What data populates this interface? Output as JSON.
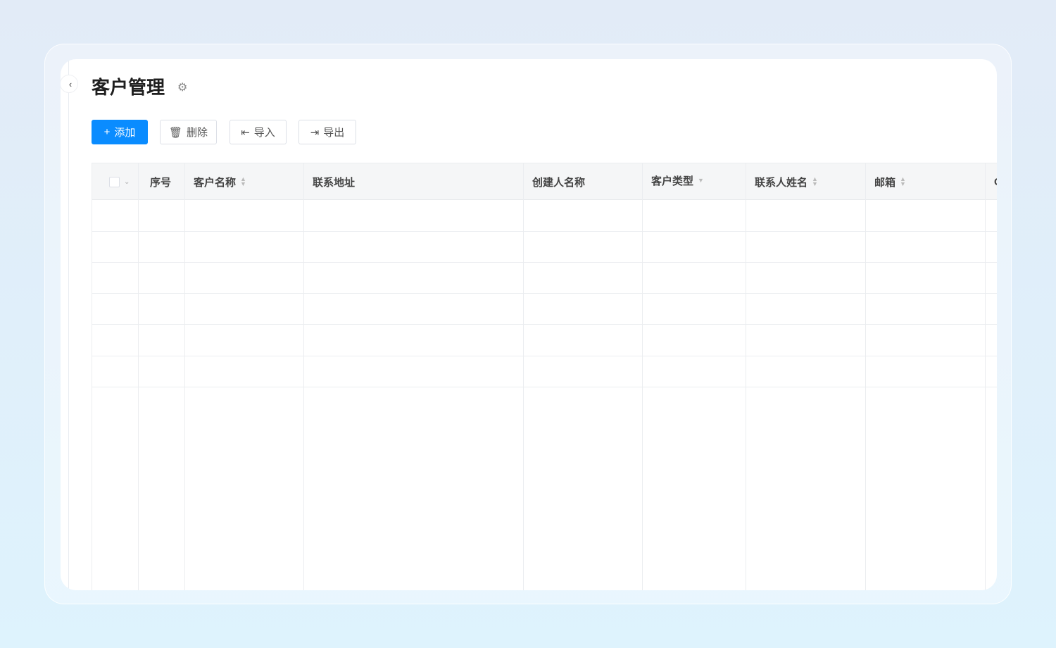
{
  "page": {
    "title": "客户管理",
    "back_icon": "chevron-left-icon",
    "settings_icon": "gear-icon"
  },
  "toolbar": {
    "add": "添加",
    "delete": "删除",
    "import": "导入",
    "export": "导出"
  },
  "table": {
    "columns": [
      {
        "label": "序号",
        "sortable": false
      },
      {
        "label": "客户名称",
        "sortable": true
      },
      {
        "label": "联系地址",
        "sortable": false
      },
      {
        "label": "创建人名称",
        "sortable": false
      },
      {
        "label": "客户类型",
        "filter": true
      },
      {
        "label": "联系人姓名",
        "sortable": true
      },
      {
        "label": "邮箱",
        "sortable": true
      },
      {
        "label": "C",
        "sortable": false
      }
    ],
    "rows": []
  },
  "colors": {
    "primary": "#0a8cff"
  }
}
